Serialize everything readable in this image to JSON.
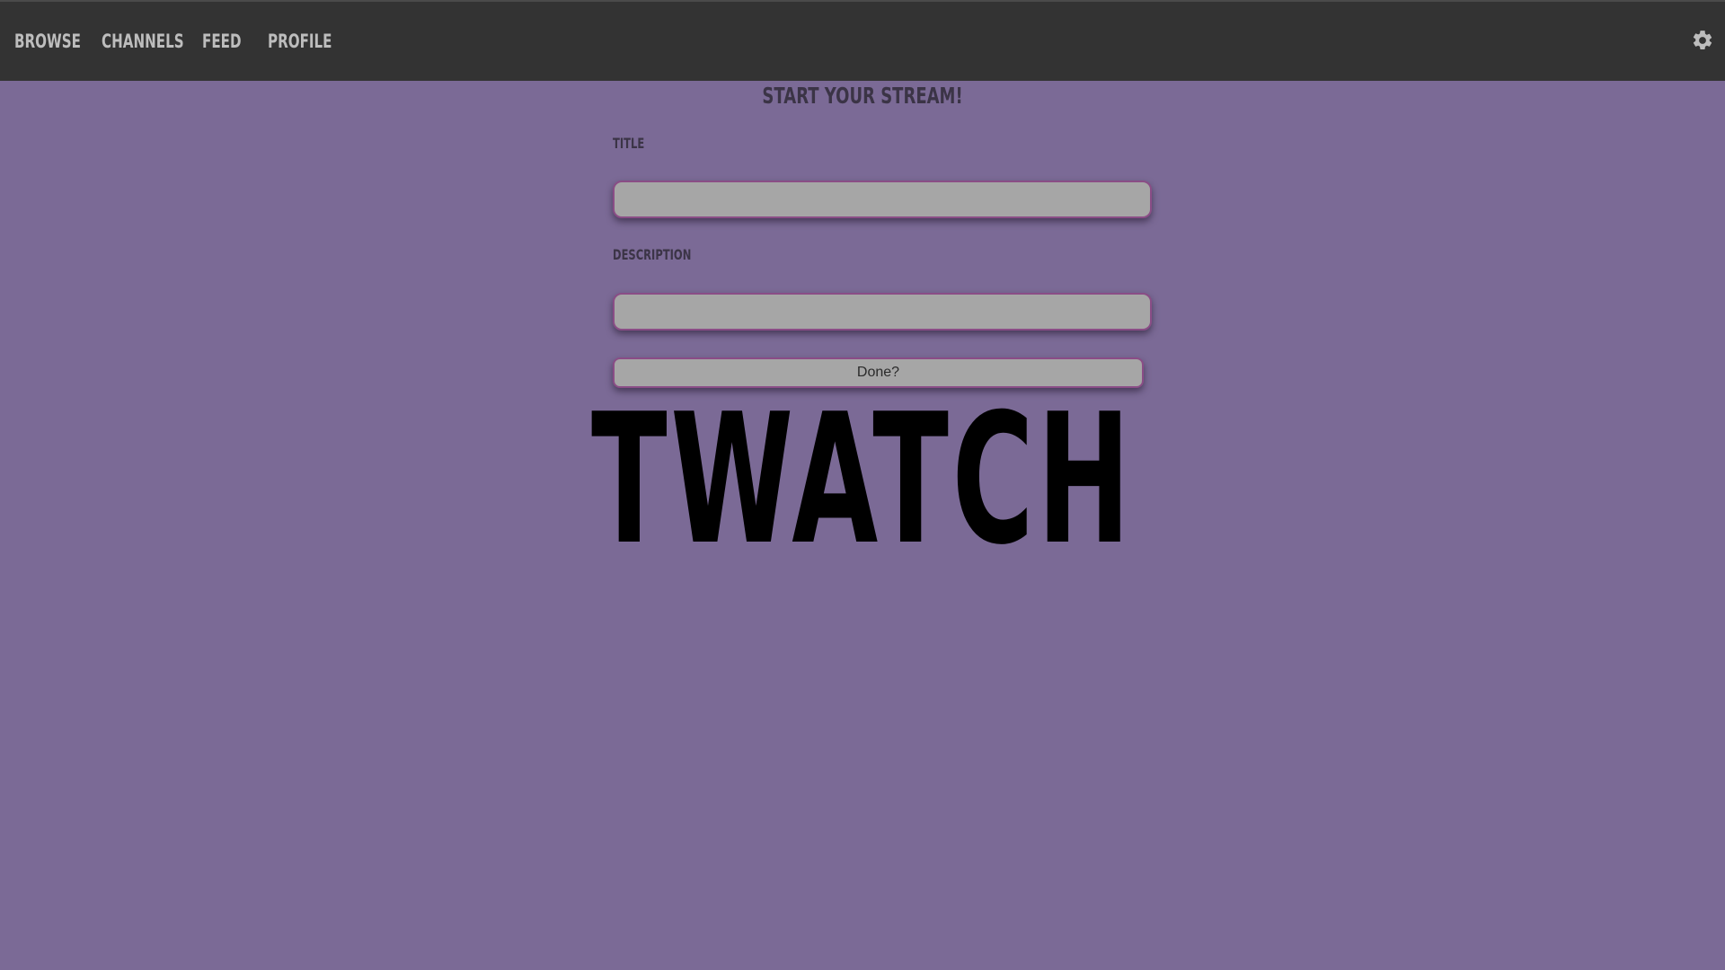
{
  "nav": {
    "items": [
      {
        "label": "BROWSE"
      },
      {
        "label": "CHANNELS"
      },
      {
        "label": "FEED"
      },
      {
        "label": "PROFILE"
      }
    ],
    "settings_icon": "gear-icon"
  },
  "form": {
    "heading": "START YOUR STREAM!",
    "title_label": "TITLE",
    "title_value": "",
    "description_label": "DESCRIPTION",
    "description_value": "",
    "submit_label": "Done?"
  },
  "logo": {
    "text": "TWATCH"
  },
  "colors": {
    "background": "#7b6a96",
    "topbar": "#333333",
    "nav_text": "#bdbdbd",
    "field_bg": "#a6a6a6",
    "field_border": "#8a4d86",
    "heading_text": "#3b3446"
  }
}
